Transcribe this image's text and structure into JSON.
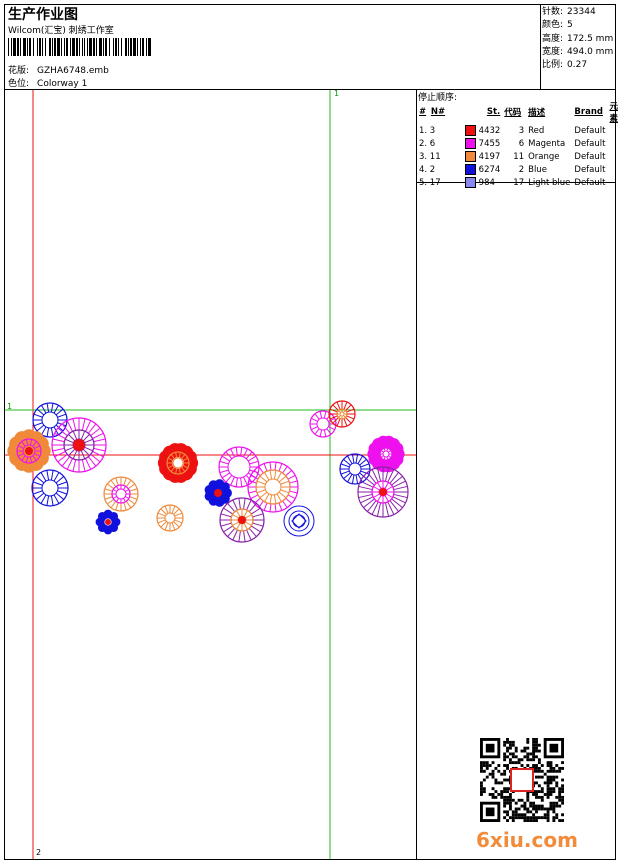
{
  "header": {
    "title": "生产作业图",
    "subtitle": "Wilcom(汇宝) 刺绣工作室",
    "pattern_label": "花版:",
    "pattern_value": "GZHA6748.emb",
    "colorway_label": "色位:",
    "colorway_value": "Colorway 1"
  },
  "stats": {
    "stitches_label": "针数:",
    "stitches_value": "23344",
    "colors_label": "颜色:",
    "colors_value": "5",
    "height_label": "高度:",
    "height_value": "172.5 mm",
    "width_label": "宽度:",
    "width_value": "494.0 mm",
    "scale_label": "比例:",
    "scale_value": "0.27"
  },
  "legend": {
    "title": "停止顺序:",
    "headers": [
      "#",
      "N#",
      "St.",
      "代码",
      "描述",
      "Brand",
      "元素"
    ],
    "rows": [
      {
        "seq": "1. 3",
        "stitches": "4432",
        "code": "3",
        "desc": "Red",
        "brand": "Default",
        "color": "#ee1111"
      },
      {
        "seq": "2. 6",
        "stitches": "7455",
        "code": "6",
        "desc": "Magenta",
        "brand": "Default",
        "color": "#ee11ee"
      },
      {
        "seq": "3. 11",
        "stitches": "4197",
        "code": "11",
        "desc": "Orange",
        "brand": "Default",
        "color": "#f08a3a"
      },
      {
        "seq": "4. 2",
        "stitches": "6274",
        "code": "2",
        "desc": "Blue",
        "brand": "Default",
        "color": "#1111dd"
      },
      {
        "seq": "5. 17",
        "stitches": "984",
        "code": "17",
        "desc": "Light blue",
        "brand": "Default",
        "color": "#8888ee"
      }
    ]
  },
  "markers": {
    "top": "1",
    "left": "1",
    "bottom": "2"
  },
  "watermark": "6xiu.com",
  "palette": {
    "red": "#ee1111",
    "magenta": "#ee11ee",
    "orange": "#f08a3a",
    "blue": "#1111dd",
    "purple": "#8822aa",
    "guide_green": "#22bb22"
  }
}
